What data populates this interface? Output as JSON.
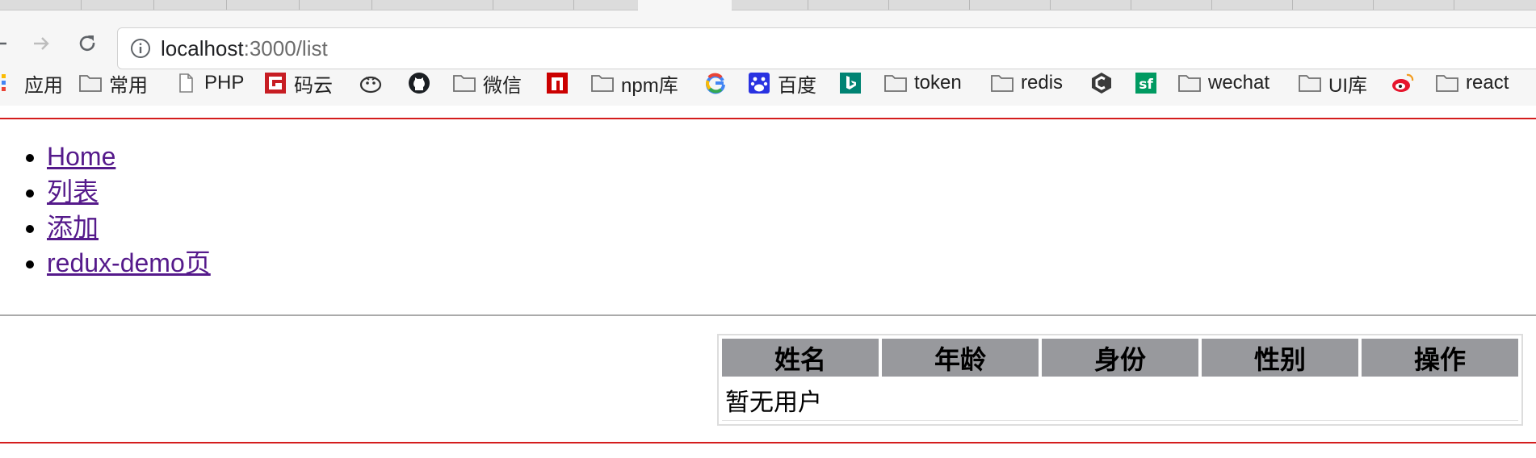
{
  "browser": {
    "url_host": "localhost",
    "url_path": ":3000/list",
    "bookmarks": [
      {
        "label": "应用",
        "icon": "apps-grid-icon"
      },
      {
        "label": "常用",
        "icon": "folder-icon"
      },
      {
        "label": "PHP",
        "icon": "page-icon"
      },
      {
        "label": "码云",
        "icon": "gitee-icon"
      },
      {
        "label": "",
        "icon": "bird-icon"
      },
      {
        "label": "",
        "icon": "github-icon"
      },
      {
        "label": "微信",
        "icon": "folder-icon"
      },
      {
        "label": "",
        "icon": "npm-icon"
      },
      {
        "label": "npm库",
        "icon": "folder-icon"
      },
      {
        "label": "",
        "icon": "google-icon"
      },
      {
        "label": "百度",
        "icon": "baidu-icon"
      },
      {
        "label": "",
        "icon": "bing-icon"
      },
      {
        "label": "token",
        "icon": "folder-icon"
      },
      {
        "label": "redis",
        "icon": "folder-icon"
      },
      {
        "label": "",
        "icon": "codepen-c-icon"
      },
      {
        "label": "",
        "icon": "segmentfault-icon"
      },
      {
        "label": "wechat",
        "icon": "folder-icon"
      },
      {
        "label": "UI库",
        "icon": "folder-icon"
      },
      {
        "label": "",
        "icon": "weibo-icon"
      },
      {
        "label": "react",
        "icon": "folder-icon"
      }
    ]
  },
  "nav": {
    "items": [
      {
        "label": "Home"
      },
      {
        "label": "列表"
      },
      {
        "label": "添加"
      },
      {
        "label": "redux-demo页"
      }
    ]
  },
  "table": {
    "headers": [
      "姓名",
      "年龄",
      "身份",
      "性别",
      "操作"
    ],
    "empty_text": "暂无用户"
  },
  "colors": {
    "accent_line": "#d41d1d",
    "header_bg": "#98999d",
    "link": "#551a8b"
  }
}
